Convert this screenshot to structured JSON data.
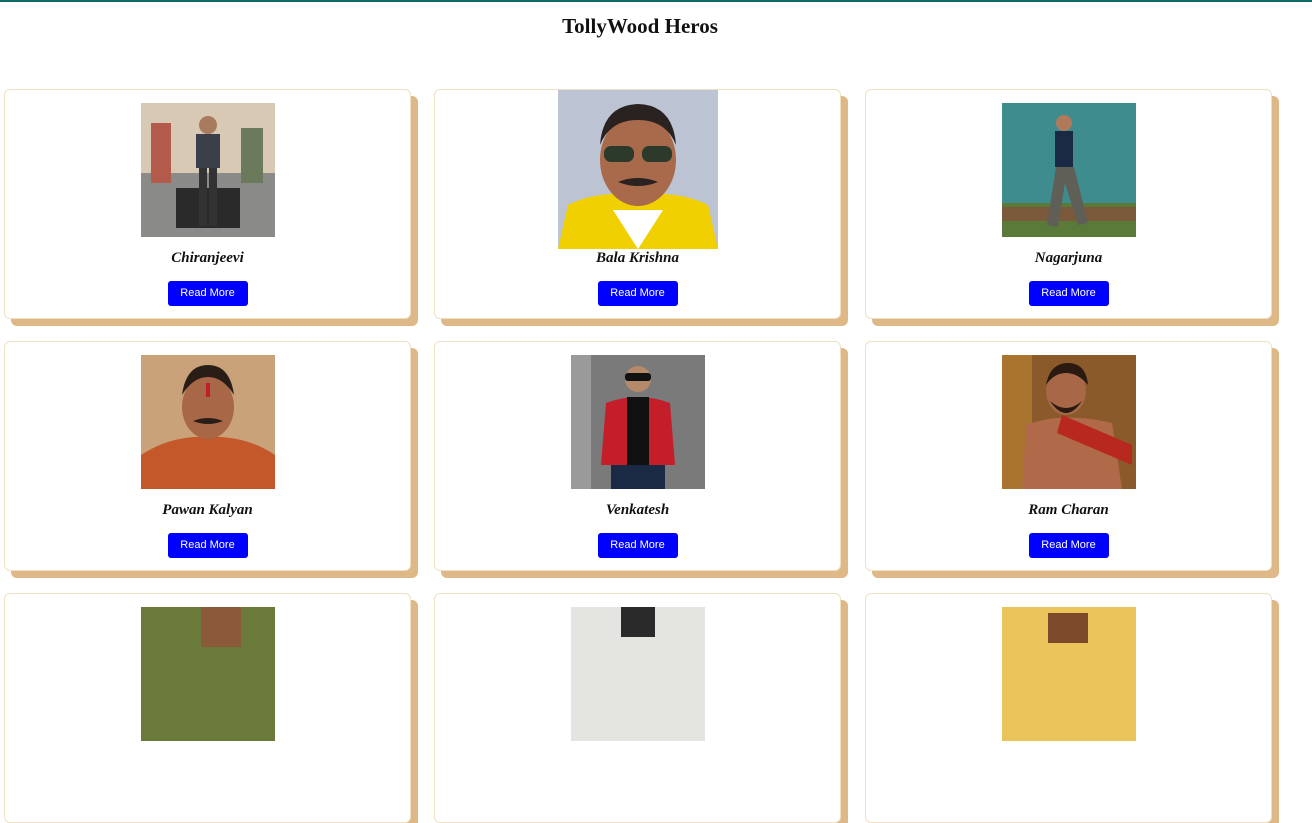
{
  "page": {
    "title": "TollyWood Heros",
    "accent_color": "#0f6b66",
    "card_shadow_color": "#deb887",
    "button_color": "#0000ff"
  },
  "cards": [
    {
      "name": "Chiranjeevi",
      "button_label": "Read More",
      "image": "hero-photo"
    },
    {
      "name": "Bala Krishna",
      "button_label": "Read More",
      "image": "hero-photo"
    },
    {
      "name": "Nagarjuna",
      "button_label": "Read More",
      "image": "hero-photo"
    },
    {
      "name": "Pawan Kalyan",
      "button_label": "Read More",
      "image": "hero-photo"
    },
    {
      "name": "Venkatesh",
      "button_label": "Read More",
      "image": "hero-photo"
    },
    {
      "name": "Ram Charan",
      "button_label": "Read More",
      "image": "hero-photo"
    },
    {
      "name": "",
      "button_label": "",
      "image": "hero-photo"
    },
    {
      "name": "",
      "button_label": "",
      "image": "hero-photo"
    },
    {
      "name": "",
      "button_label": "",
      "image": "hero-photo"
    }
  ]
}
